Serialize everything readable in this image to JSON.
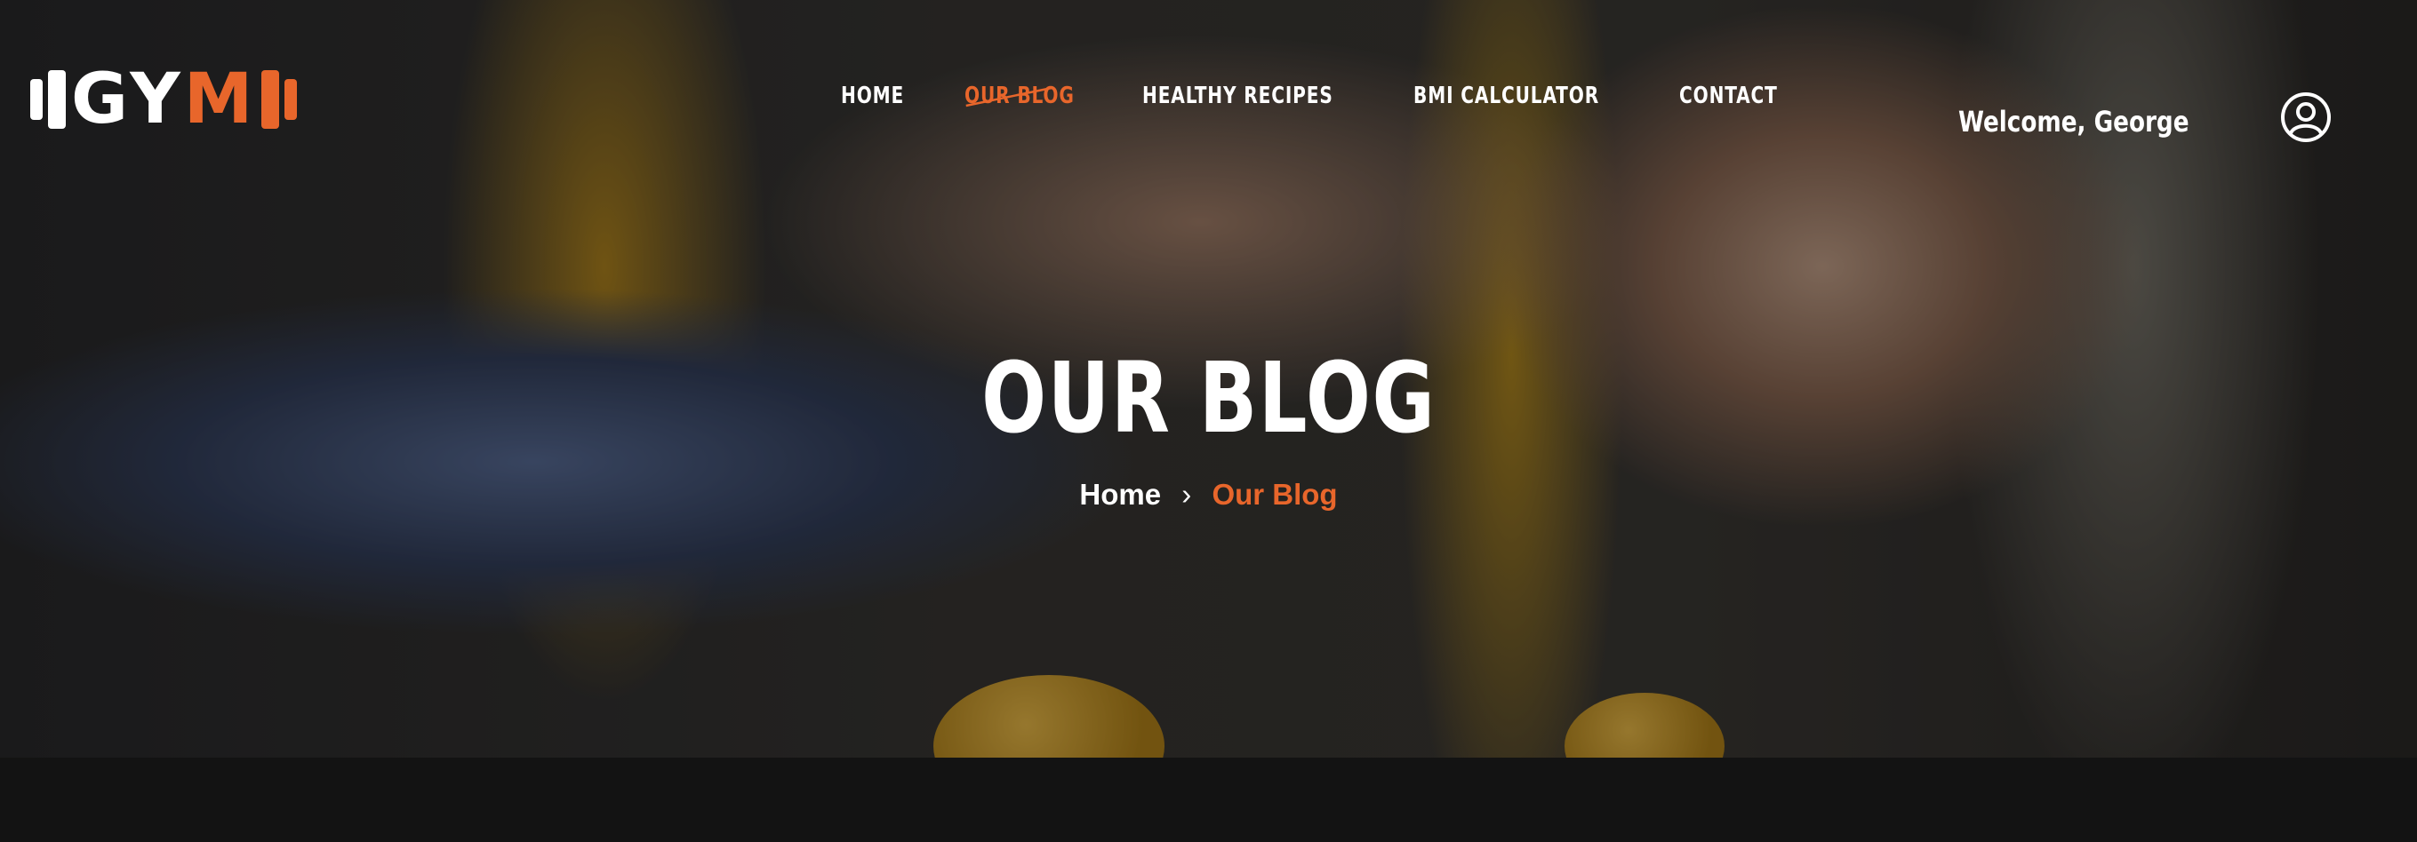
{
  "brand": {
    "letters": "GY",
    "accent_letter": "M",
    "accent_color": "#e8662b"
  },
  "nav": {
    "items": [
      {
        "label": "HOME"
      },
      {
        "label": "OUR BLOG",
        "active": true
      },
      {
        "label": "HEALTHY RECIPES"
      },
      {
        "label": "BMI CALCULATOR"
      },
      {
        "label": "CONTACT"
      }
    ]
  },
  "header": {
    "welcome": "Welcome, George",
    "user_icon": "user-circle-icon"
  },
  "hero": {
    "title": "OUR BLOG",
    "breadcrumb": {
      "home": "Home",
      "separator": "›",
      "current": "Our Blog"
    }
  },
  "colors": {
    "accent": "#e8662b",
    "footer_bg": "#131313"
  }
}
